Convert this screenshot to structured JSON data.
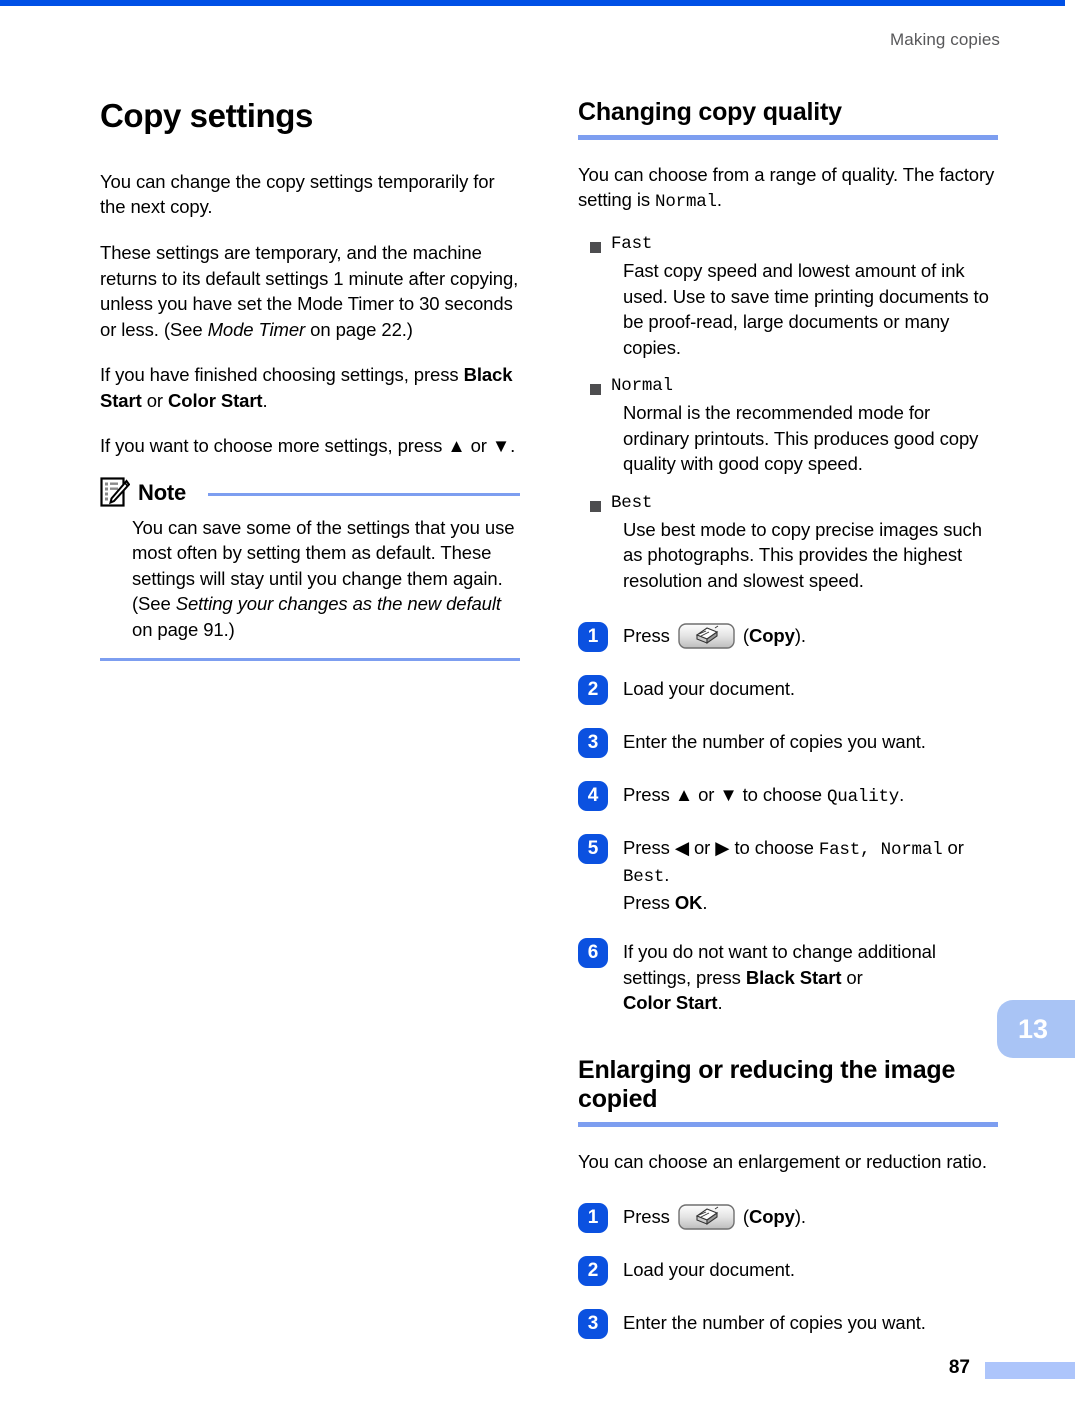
{
  "header": {
    "running_title": "Making copies",
    "chapter_tab": "13",
    "page_number": "87"
  },
  "left_column": {
    "title": "Copy settings",
    "paragraphs": [
      "You can change the copy settings temporarily for the next copy.",
      "These settings are temporary, and the machine returns to its default settings 1 minute after copying, unless you have set the Mode Timer to 30 seconds or less. (See ",
      "If you have finished choosing settings, press ",
      "If you want to choose more settings, press ▲ or ▼."
    ],
    "p2_italic_ref": "Mode Timer",
    "p2_tail": " on page 22.)",
    "p3_bold_a": "Black Start",
    "p3_mid": " or ",
    "p3_bold_b": "Color Start",
    "p3_tail": ".",
    "note": {
      "label": "Note",
      "icon": "note-pencil-icon",
      "text_lead": "You can save some of the settings that you use most often by setting them as default. These settings will stay until you change them again. (See ",
      "text_italic": "Setting your changes as the new default",
      "text_tail": " on page 91.)"
    }
  },
  "right_column": {
    "section_quality": {
      "title": "Changing copy quality",
      "intro_lead": "You can choose from a range of quality. The factory setting is ",
      "intro_mono": "Normal",
      "intro_tail": ".",
      "options": [
        {
          "name": "Fast",
          "description": "Fast copy speed and lowest amount of ink used. Use to save time printing documents to be proof-read, large documents or many copies."
        },
        {
          "name": "Normal",
          "description": "Normal is the recommended mode for ordinary printouts. This produces good copy quality with good copy speed."
        },
        {
          "name": "Best",
          "description": "Use best mode to copy precise images such as photographs. This provides the highest resolution and slowest speed."
        }
      ],
      "steps": [
        {
          "num": "1",
          "lead": "Press ",
          "has_key": true,
          "key_icon": "copy-key-icon",
          "mid": " (",
          "bold": "Copy",
          "tail": ")."
        },
        {
          "num": "2",
          "lead": "Load your document.",
          "has_key": false
        },
        {
          "num": "3",
          "lead": "Enter the number of copies you want.",
          "has_key": false
        },
        {
          "num": "4",
          "lead": "Press ▲ or ▼ to choose ",
          "mono": "Quality",
          "tail": ".",
          "has_key": false
        },
        {
          "num": "5",
          "lead": "Press ◀ or ▶ to choose ",
          "mono_a": "Fast",
          "sep1": ", ",
          "mono_b": "Normal",
          "mid": " or ",
          "mono_c": "Best",
          "tail": ".",
          "second_line_lead": "Press ",
          "second_line_bold": "OK",
          "second_line_tail": ".",
          "has_key": false
        },
        {
          "num": "6",
          "lead": "If you do not want to change additional settings, press ",
          "bold_a": "Black Start",
          "mid": " or ",
          "bold_b": "Color Start",
          "tail": ".",
          "has_key": false
        }
      ]
    },
    "section_enlarge": {
      "title": "Enlarging or reducing the image copied",
      "intro": "You can choose an enlargement or reduction ratio.",
      "steps": [
        {
          "num": "1",
          "lead": "Press ",
          "has_key": true,
          "key_icon": "copy-key-icon",
          "mid": " (",
          "bold": "Copy",
          "tail": ")."
        },
        {
          "num": "2",
          "lead": "Load your document.",
          "has_key": false
        },
        {
          "num": "3",
          "lead": "Enter the number of copies you want.",
          "has_key": false
        }
      ]
    }
  },
  "colors": {
    "top_rule": "#0050e6",
    "heading_rule": "#7d9ef0",
    "step_badge": "#0b51e0",
    "chapter_tab": "#a9c4f5",
    "footer_bar": "#adc5fb",
    "bullet": "#4d4d4f",
    "header_text": "#58585a"
  }
}
